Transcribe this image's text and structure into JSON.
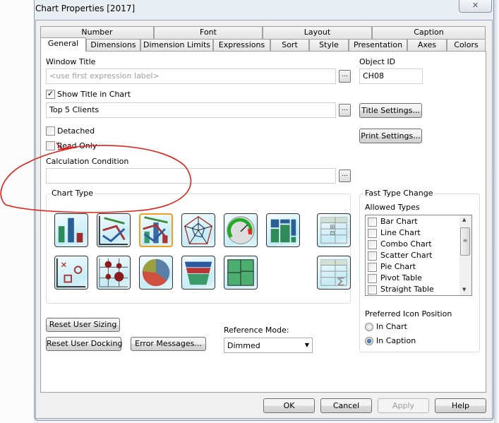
{
  "window": {
    "title": "Chart Properties [2017]",
    "close_icon": "close-icon"
  },
  "tabs_row1": [
    {
      "label": "Number"
    },
    {
      "label": "Font"
    },
    {
      "label": "Layout"
    },
    {
      "label": "Caption"
    }
  ],
  "tabs_row2": [
    {
      "label": "General",
      "selected": true
    },
    {
      "label": "Dimensions"
    },
    {
      "label": "Dimension Limits"
    },
    {
      "label": "Expressions"
    },
    {
      "label": "Sort"
    },
    {
      "label": "Style"
    },
    {
      "label": "Presentation"
    },
    {
      "label": "Axes"
    },
    {
      "label": "Colors"
    }
  ],
  "general": {
    "window_title_label": "Window Title",
    "window_title_placeholder": "<use first expression label>",
    "object_id_label": "Object ID",
    "object_id_value": "CH08",
    "show_title_label": "Show Title in Chart",
    "show_title_checked": true,
    "title_value": "Top 5 Clients",
    "title_settings_label": "Title Settings...",
    "detached_label": "Detached",
    "read_only_label": "Read Only",
    "print_settings_label": "Print Settings...",
    "calc_condition_label": "Calculation Condition",
    "calc_condition_value": "",
    "ellipsis": "...",
    "chart_type_label": "Chart Type",
    "chart_types": [
      "bar-chart",
      "line-chart",
      "combo-chart",
      "radar-chart",
      "gauge-chart",
      "mekko-chart",
      "pivot-table",
      "scatter-chart",
      "grid-chart",
      "pie-chart",
      "funnel-chart",
      "block-chart",
      "straight-table"
    ],
    "selected_chart_type": "combo-chart",
    "fast_type_change_label": "Fast Type Change",
    "allowed_types_label": "Allowed Types",
    "allowed_types": [
      {
        "label": "Bar Chart",
        "checked": false
      },
      {
        "label": "Line Chart",
        "checked": false
      },
      {
        "label": "Combo Chart",
        "checked": false
      },
      {
        "label": "Scatter Chart",
        "checked": false
      },
      {
        "label": "Pie Chart",
        "checked": false
      },
      {
        "label": "Pivot Table",
        "checked": false
      },
      {
        "label": "Straight Table",
        "checked": false
      }
    ],
    "preferred_icon_position_label": "Preferred Icon Position",
    "icon_position_options": [
      {
        "label": "In Chart",
        "selected": false
      },
      {
        "label": "In Caption",
        "selected": true
      }
    ],
    "reset_user_sizing_label": "Reset User Sizing",
    "reset_user_docking_label": "Reset User Docking",
    "error_messages_label": "Error Messages...",
    "reference_mode_label": "Reference Mode:",
    "reference_mode_value": "Dimmed"
  },
  "footer": {
    "ok": "OK",
    "cancel": "Cancel",
    "apply": "Apply",
    "help": "Help"
  },
  "colors": {
    "annotation": "#e0201a",
    "selected_icon_border": "#f0a020"
  }
}
